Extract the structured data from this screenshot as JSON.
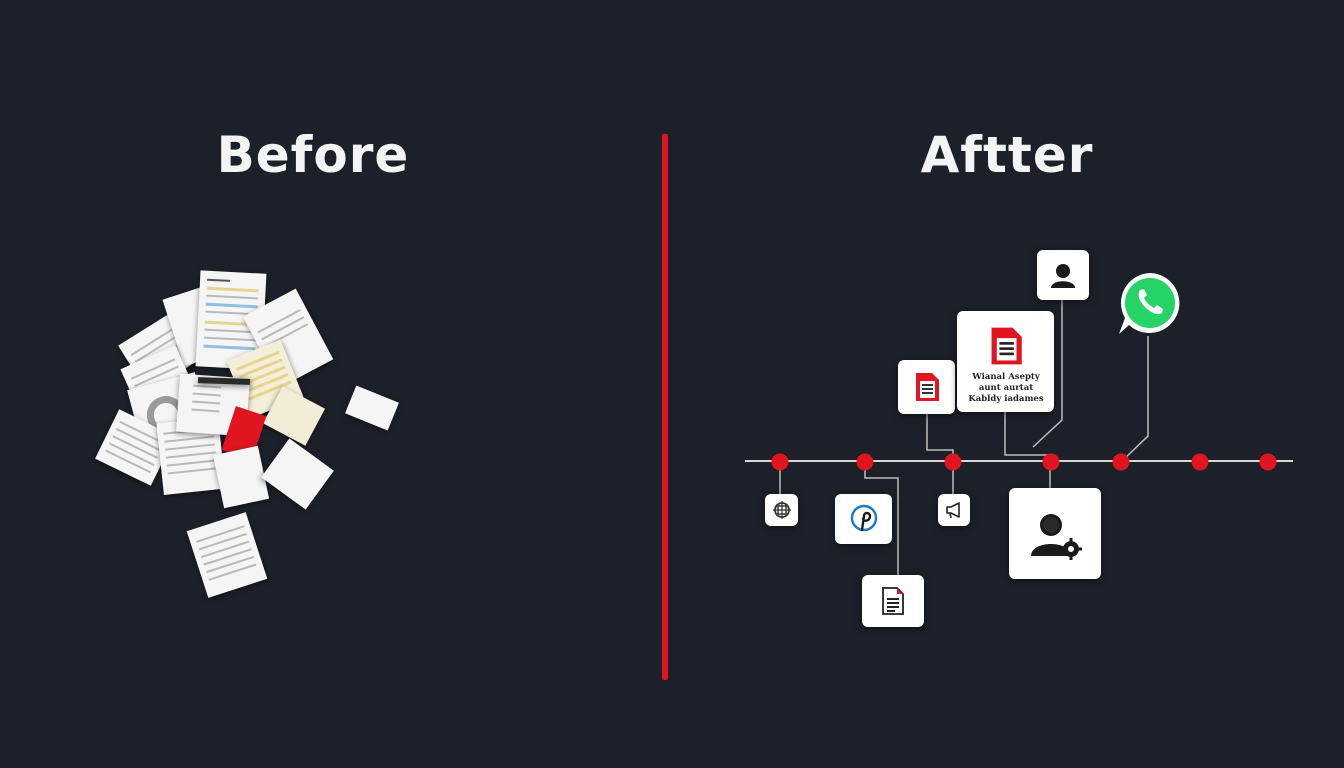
{
  "headings": {
    "before": "Before",
    "after": "Aftter"
  },
  "colors": {
    "background": "#1c2129",
    "accent": "#e0151f",
    "card": "#ffffff",
    "whatsapp": "#25d366",
    "timeline": "#d7d7d7"
  },
  "after_panel": {
    "document_card_text": [
      "Wianal Asepty",
      "aunt aurtat",
      "Kabldy iadames"
    ],
    "timeline_nodes": 7,
    "icons_above": [
      "document-icon",
      "document-icon",
      "user-icon",
      "whatsapp-icon"
    ],
    "icons_below": [
      "crosshair-icon",
      "pinterest-icon",
      "megaphone-icon",
      "document-icon",
      "user-settings-icon"
    ]
  }
}
